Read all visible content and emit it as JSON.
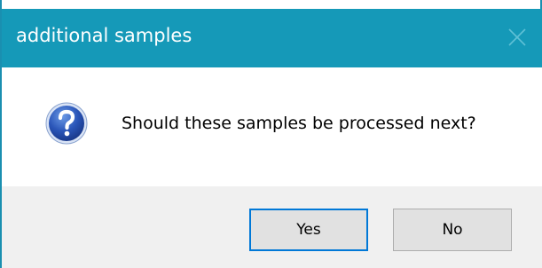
{
  "dialog": {
    "title": "additional samples",
    "message": "Should these samples be processed next?",
    "icon": "question-icon",
    "buttons": {
      "yes_label": "Yes",
      "no_label": "No"
    }
  },
  "colors": {
    "titlebar": "#1599b8",
    "footer": "#f0f0f0",
    "default_button_border": "#0078d7"
  }
}
